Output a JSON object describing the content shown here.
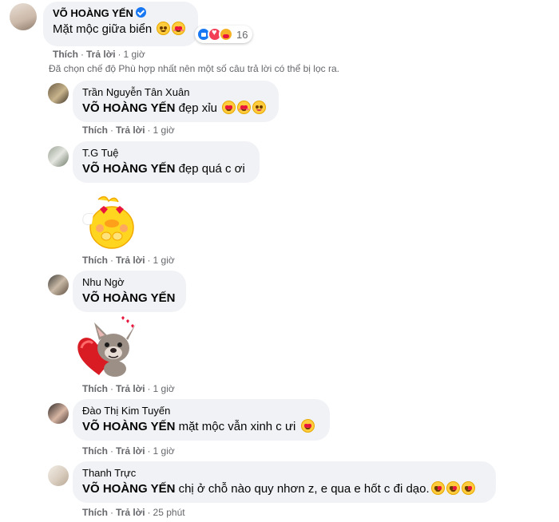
{
  "main_comment": {
    "author": "VÕ HOÀNG YẾN",
    "text": "Mặt mộc giữa biển",
    "emojis": [
      "smiling-face-icon",
      "smiling-face-with-hearts-icon"
    ],
    "reaction_count": "16",
    "reaction_icons": [
      "like-icon",
      "love-icon",
      "care-icon"
    ],
    "like_label": "Thích",
    "reply_label": "Trả lời",
    "time": "1 giờ"
  },
  "filter_note": "Đã chọn chế độ Phù hợp nhất nên một số câu trả lời có thể bị lọc ra.",
  "replies": [
    {
      "author": "Trần Nguyễn Tân Xuân",
      "tag": "VÕ HOÀNG YẾN",
      "text": " đẹp xỉu",
      "emojis": [
        "heart-eyes-icon",
        "smiling-face-with-hearts-icon",
        "winking-tongue-icon"
      ],
      "like_label": "Thích",
      "reply_label": "Trả lời",
      "time": "1 giờ"
    },
    {
      "author": "T.G Tuệ",
      "tag": "VÕ HOÀNG YẾN",
      "text": " đẹp quá c ơi",
      "sticker": "heart-eyes-duck-sticker",
      "like_label": "Thích",
      "reply_label": "Trả lời",
      "time": "1 giờ"
    },
    {
      "author": "Nhu Ngờ",
      "tag": "VÕ HOÀNG YẾN",
      "text": "",
      "sticker": "bulldog-heart-sticker",
      "like_label": "Thích",
      "reply_label": "Trả lời",
      "time": "1 giờ"
    },
    {
      "author": "Đào Thị Kim Tuyến",
      "tag": "VÕ HOÀNG YẾN",
      "text": " mặt mộc vẫn xinh c ưi",
      "emojis": [
        "heart-eyes-icon"
      ],
      "like_label": "Thích",
      "reply_label": "Trả lời",
      "time": "1 giờ"
    },
    {
      "author": "Thanh Trực",
      "tag": "VÕ HOÀNG YẾN",
      "text": " chị ở chỗ nào quy nhơn z, e qua e hốt c đi dạo.",
      "emojis": [
        "kissing-heart-icon",
        "kissing-heart-icon",
        "kissing-heart-icon"
      ],
      "like_label": "Thích",
      "reply_label": "Trả lời",
      "time": "25 phút"
    }
  ]
}
